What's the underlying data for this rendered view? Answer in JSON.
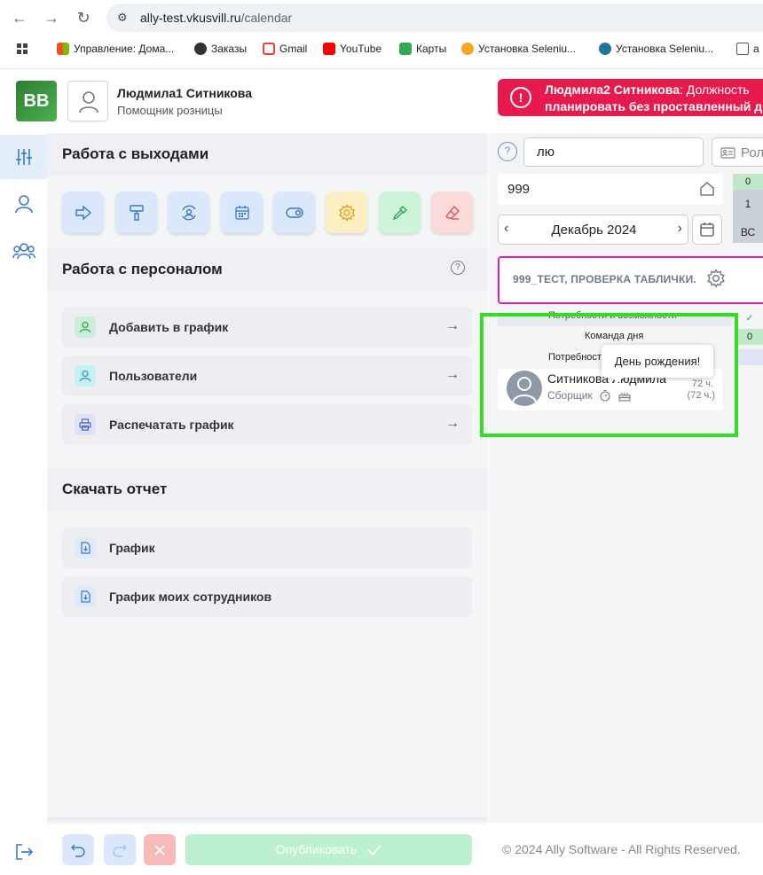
{
  "browser": {
    "url_host": "ally-test.vkusvill.ru",
    "url_path": "/calendar",
    "bookmarks": [
      {
        "label": "Управление: Дома...",
        "color": "#f25022"
      },
      {
        "label": "Заказы",
        "color": "#333333"
      },
      {
        "label": "Gmail",
        "color": "#ea4335"
      },
      {
        "label": "YouTube",
        "color": "#ff0000"
      },
      {
        "label": "Карты",
        "color": "#34a853"
      },
      {
        "label": "Установка Seleniu...",
        "color": "#f5a623"
      },
      {
        "label": "Установка Seleniu...",
        "color": "#21759b"
      },
      {
        "label": "а",
        "color": "#555555"
      }
    ]
  },
  "header": {
    "logo_text": "ВВ",
    "user_name": "Людмила1 Ситникова",
    "user_role": "Помощник розницы",
    "alert_name": "Людмила2 Ситникова",
    "alert_line1_rest": ": Должность",
    "alert_line2": "планировать без проставленный д"
  },
  "left": {
    "shifts_title": "Работа с выходами",
    "staff_title": "Работа с персоналом",
    "staff_rows": [
      {
        "label": "Добавить в график"
      },
      {
        "label": "Пользователи"
      },
      {
        "label": "Распечатать график"
      }
    ],
    "report_title": "Скачать отчет",
    "report_rows": [
      {
        "label": "График"
      },
      {
        "label": "График моих сотрудников"
      }
    ]
  },
  "right": {
    "search_value": "лю",
    "role_placeholder": "Рол",
    "shop_value": "999",
    "day_top": "0",
    "day_num": "1",
    "day_name": "ВС",
    "month_label": "Декабрь 2024",
    "team_label": "999_ТЕСТ, ПРОВЕРКА ТАБЛИЧКИ.",
    "needs_label": "Потребности и возможности",
    "team_day_label": "Команда дня",
    "team_day_value": "0",
    "needs_label2": "Потребност",
    "employee": {
      "name": "Ситникова Людмила",
      "role": "Сборщик",
      "hours1": "72 ч.",
      "hours2": "(72 ч.)"
    },
    "tooltip": "День рождения!"
  },
  "footer": {
    "publish_label": "Опубликовать",
    "copyright": "© 2024 Ally Software - All Rights Reserved."
  }
}
